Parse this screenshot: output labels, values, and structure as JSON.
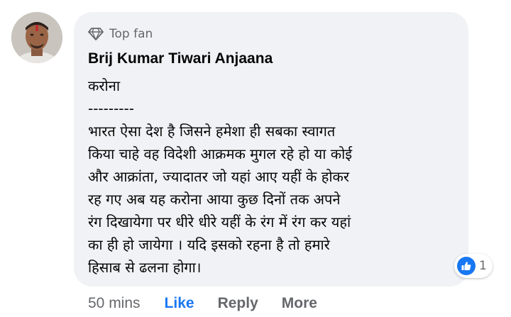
{
  "comment": {
    "badge_label": "Top fan",
    "badge_icon": "diamond-icon",
    "author": "Brij Kumar Tiwari Anjaana",
    "body_lines": [
      "करोना",
      "---------",
      "भारत ऐसा देश है जिसने हमेशा ही सबका स्वागत",
      "किया चाहे वह विदेशी आक्रमक मुगल रहे हो या कोई",
      "और आक्रांता, ज्यादातर जो यहां आए यहीं के होकर",
      "रह गए अब यह करोना आया कुछ दिनों तक अपने",
      "रंग दिखायेगा पर धीरे धीरे यहीं के रंग में रंग कर यहां",
      "का ही हो जायेगा । यदि इसको रहना है तो हमारे",
      "हिसाब से ढलना होगा।"
    ],
    "reaction_icon": "like-thumb-icon",
    "reaction_count": "1"
  },
  "actions": {
    "time": "50 mins",
    "like": "Like",
    "reply": "Reply",
    "more": "More"
  },
  "colors": {
    "bubble": "#f0f2f5",
    "like_blue": "#1877f2",
    "secondary_text": "#65676b",
    "primary_text": "#050505"
  }
}
